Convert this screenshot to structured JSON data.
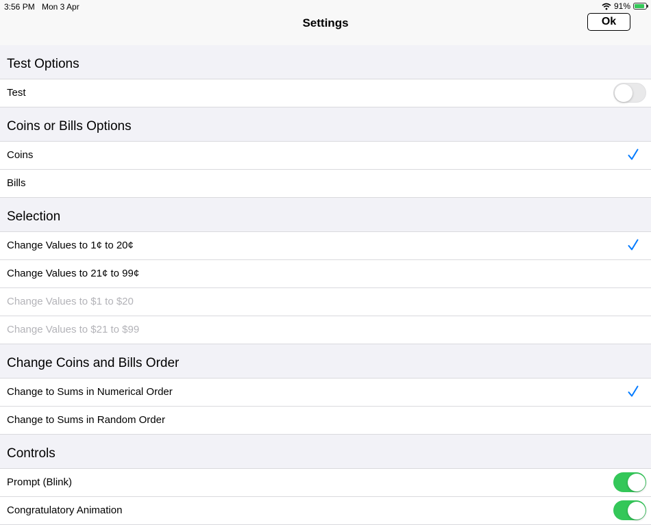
{
  "status_bar": {
    "time": "3:56 PM",
    "date": "Mon 3 Apr",
    "battery": "91%"
  },
  "nav": {
    "title": "Settings",
    "ok_label": "Ok"
  },
  "sections": [
    {
      "header": "Test Options",
      "rows": [
        {
          "label": "Test",
          "accessory": "toggle",
          "on": false
        }
      ]
    },
    {
      "header": "Coins or Bills Options",
      "rows": [
        {
          "label": "Coins",
          "accessory": "check",
          "checked": true
        },
        {
          "label": "Bills",
          "accessory": "check",
          "checked": false
        }
      ]
    },
    {
      "header": "Selection",
      "rows": [
        {
          "label": "Change Values to 1¢ to 20¢",
          "accessory": "check",
          "checked": true,
          "enabled": true
        },
        {
          "label": "Change Values to 21¢ to 99¢",
          "accessory": "check",
          "checked": false,
          "enabled": true
        },
        {
          "label": "Change Values to $1 to $20",
          "accessory": "check",
          "checked": false,
          "enabled": false
        },
        {
          "label": "Change Values to $21 to $99",
          "accessory": "check",
          "checked": false,
          "enabled": false
        }
      ]
    },
    {
      "header": "Change Coins and Bills Order",
      "rows": [
        {
          "label": "Change to Sums in Numerical Order",
          "accessory": "check",
          "checked": true
        },
        {
          "label": "Change to Sums in Random Order",
          "accessory": "check",
          "checked": false
        }
      ]
    },
    {
      "header": "Controls",
      "rows": [
        {
          "label": "Prompt (Blink)",
          "accessory": "toggle",
          "on": true
        },
        {
          "label": "Congratulatory Animation",
          "accessory": "toggle",
          "on": true
        }
      ]
    }
  ],
  "colors": {
    "accent": "#007aff",
    "toggle_on": "#34c759",
    "disabled_text": "#b3b3b8"
  },
  "icons": {
    "check": "checkmark-icon",
    "wifi": "wifi-icon",
    "battery": "battery-charging-icon"
  }
}
